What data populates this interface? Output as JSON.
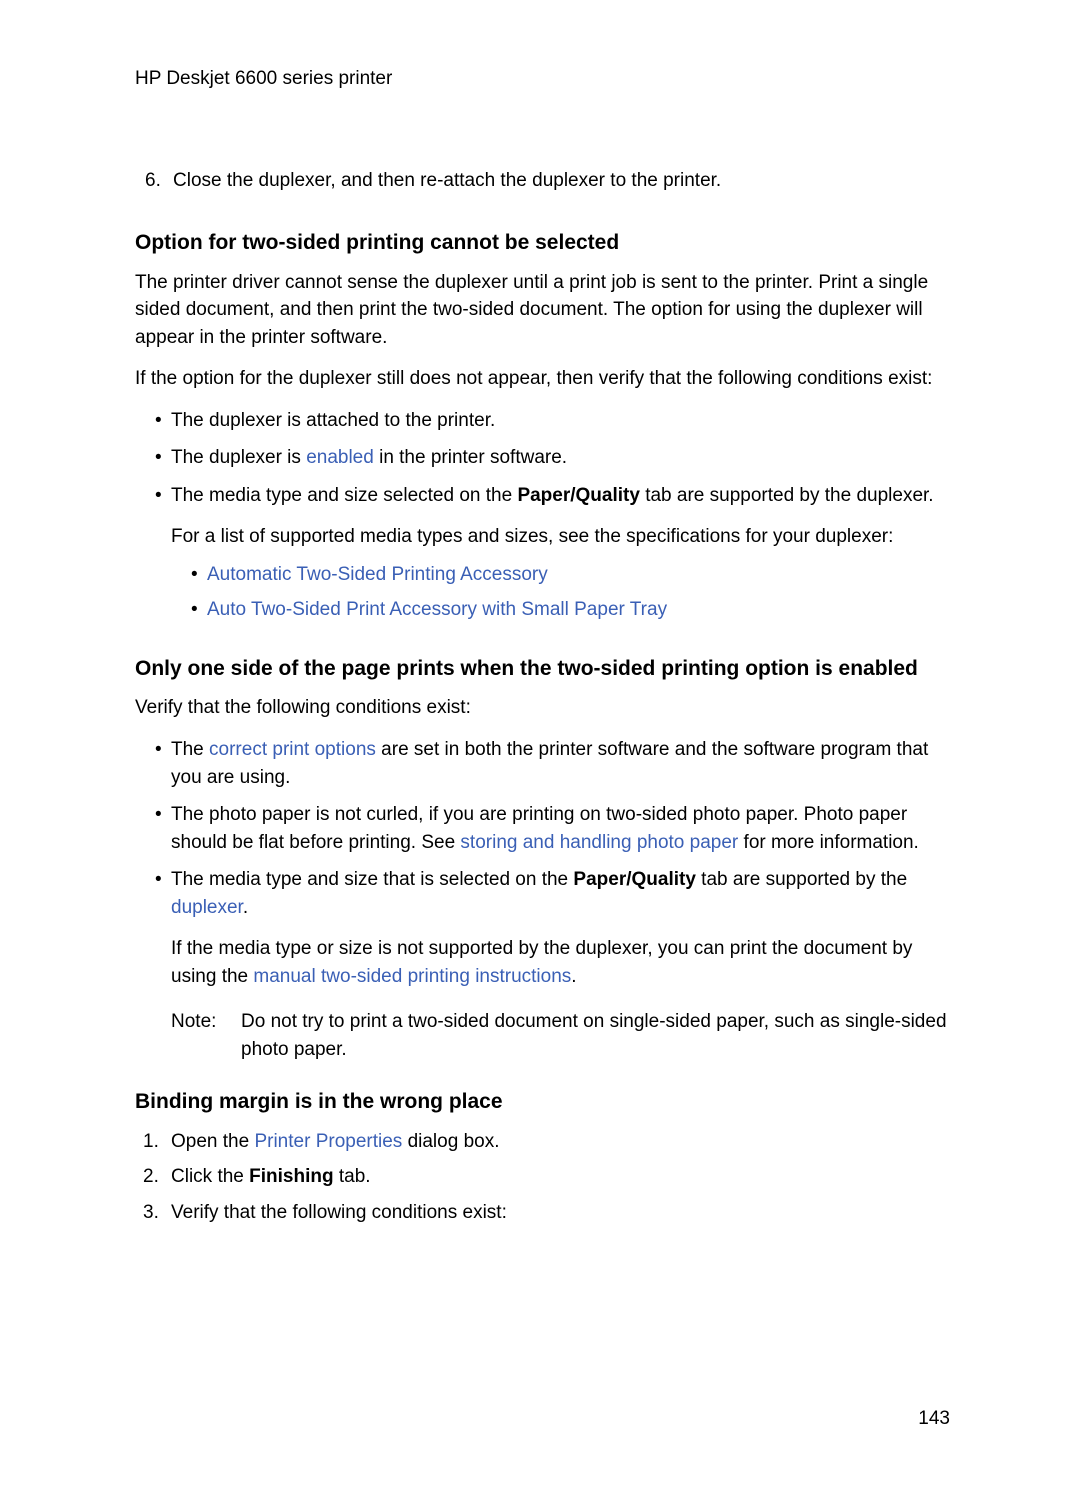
{
  "header": {
    "title": "HP Deskjet 6600 series printer"
  },
  "ol6": {
    "num": "6.",
    "text": "Close the duplexer, and then re-attach the duplexer to the printer."
  },
  "sec1": {
    "heading": "Option for two-sided printing cannot be selected",
    "p1": "The printer driver cannot sense the duplexer until a print job is sent to the printer. Print a single sided document, and then print the two-sided document. The option for using the duplexer will appear in the printer software.",
    "p2": "If the option for the duplexer still does not appear, then verify that the following conditions exist:",
    "b1": "The duplexer is attached to the printer.",
    "b2_pre": "The duplexer is ",
    "b2_link": "enabled",
    "b2_post": " in the printer software.",
    "b3_pre": "The media type and size selected on the ",
    "b3_bold": "Paper/Quality",
    "b3_post": " tab are supported by the duplexer.",
    "b3_sub": "For a list of supported media types and sizes, see the specifications for your duplexer:",
    "sub_link1": "Automatic Two-Sided Printing Accessory",
    "sub_link2": "Auto Two-Sided Print Accessory with Small Paper Tray"
  },
  "sec2": {
    "heading": "Only one side of the page prints when the two-sided printing option is enabled",
    "p1": "Verify that the following conditions exist:",
    "b1_pre": "The ",
    "b1_link": "correct print options",
    "b1_post": " are set in both the printer software and the software program that you are using.",
    "b2_pre": "The photo paper is not curled, if you are printing on two-sided photo paper. Photo paper should be flat before printing. See ",
    "b2_link": "storing and handling photo paper",
    "b2_post": " for more information.",
    "b3_pre": "The media type and size that is selected on the ",
    "b3_bold": "Paper/Quality",
    "b3_mid": " tab are supported by the ",
    "b3_link": "duplexer",
    "b3_post": ".",
    "b3_sub_pre": "If the media type or size is not supported by the duplexer, you can print the document by using the ",
    "b3_sub_link": "manual two-sided printing instructions",
    "b3_sub_post": ".",
    "note_label": "Note:",
    "note_text": "Do not try to print a two-sided document on single-sided paper, such as single-sided photo paper."
  },
  "sec3": {
    "heading": "Binding margin is in the wrong place",
    "s1_num": "1.",
    "s1_pre": "Open the ",
    "s1_link": "Printer Properties",
    "s1_post": " dialog box.",
    "s2_num": "2.",
    "s2_pre": "Click the ",
    "s2_bold": "Finishing",
    "s2_post": " tab.",
    "s3_num": "3.",
    "s3_text": "Verify that the following conditions exist:"
  },
  "page_number": "143"
}
